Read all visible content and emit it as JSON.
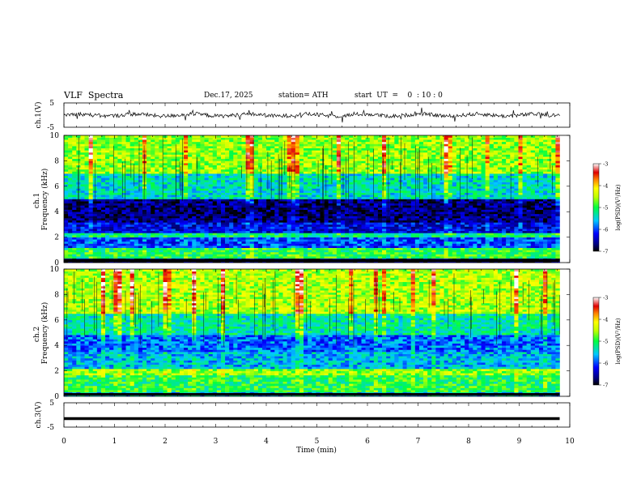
{
  "header": {
    "title": "VLF  Spectra",
    "date": "Dec.17, 2025",
    "station": "station= ATH",
    "start": "start  UT  =    0  : 10 : 0"
  },
  "chart_data": [
    {
      "type": "line",
      "panel": "ch1-waveform",
      "ylabel": "ch.1(V)",
      "ylim": [
        -5,
        5
      ],
      "yticks": [
        5,
        -5
      ],
      "x_range_min": [
        0,
        9.8
      ],
      "series_color": "#000000",
      "description_values": "noisy waveform centered near 0 V with spikes"
    },
    {
      "type": "heatmap",
      "panel": "ch1-spectrogram",
      "ylabel": "ch.1\nFrequency  (kHz)",
      "ylim": [
        0,
        10
      ],
      "yticks": [
        0,
        2,
        4,
        6,
        8,
        10
      ],
      "x_range_min": [
        0,
        9.8
      ],
      "colorbar": {
        "label": "log(PSD)(V²/Hz)",
        "range": [
          -7,
          -3
        ],
        "ticks": [
          -3,
          -4,
          -5,
          -6,
          -7
        ]
      },
      "bands_khz": [
        [
          0,
          0.4,
          -6.8
        ],
        [
          0.4,
          1.2,
          -5.0
        ],
        [
          1.2,
          2.0,
          -6.0
        ],
        [
          2.0,
          2.3,
          -5.2
        ],
        [
          2.3,
          3.2,
          -6.3
        ],
        [
          3.2,
          5.0,
          -6.7
        ],
        [
          5.0,
          7.0,
          -5.4
        ],
        [
          7.0,
          10.0,
          -4.6
        ]
      ]
    },
    {
      "type": "heatmap",
      "panel": "ch2-spectrogram",
      "ylabel": "ch.2\nFrequency  (kHz)",
      "ylim": [
        0,
        10
      ],
      "yticks": [
        0,
        2,
        4,
        6,
        8,
        10
      ],
      "x_range_min": [
        0,
        9.8
      ],
      "colorbar": {
        "label": "log(PSD)(V²/Hz)",
        "range": [
          -7,
          -3
        ],
        "ticks": [
          -3,
          -4,
          -5,
          -6,
          -7
        ]
      },
      "bands_khz": [
        [
          0,
          0.4,
          -5.6
        ],
        [
          0.4,
          1.6,
          -5.0
        ],
        [
          1.6,
          2.2,
          -4.6
        ],
        [
          2.2,
          3.5,
          -5.6
        ],
        [
          3.5,
          4.8,
          -5.9
        ],
        [
          4.8,
          6.5,
          -5.3
        ],
        [
          6.5,
          10.0,
          -4.5
        ]
      ]
    },
    {
      "type": "line",
      "panel": "ch3-waveform",
      "ylabel": "ch.3(V)",
      "ylim": [
        -5,
        5
      ],
      "yticks": [
        5,
        -5
      ],
      "x_range_min": [
        0,
        9.8
      ],
      "series_color": "#000000",
      "level_v": -1.5
    }
  ],
  "xaxis": {
    "label": "Time  (min)",
    "range": [
      0,
      10
    ],
    "ticks": [
      "0",
      "1",
      "2",
      "3",
      "4",
      "5",
      "6",
      "7",
      "8",
      "9",
      "10"
    ]
  }
}
